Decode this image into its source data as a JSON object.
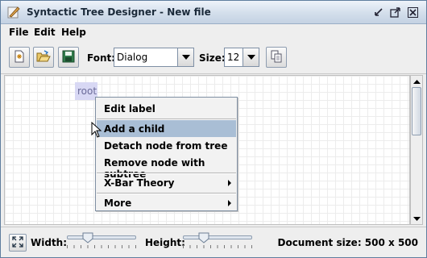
{
  "window": {
    "title": "Syntactic Tree Designer - New file",
    "controls": [
      "minimize-icon",
      "maximize-icon",
      "close-icon"
    ]
  },
  "menubar": {
    "items": [
      "File",
      "Edit",
      "Help"
    ]
  },
  "toolbar": {
    "buttons": [
      "new-file-icon",
      "open-folder-icon",
      "save-disk-icon",
      "copy-icon"
    ],
    "font_label": "Font:",
    "font_value": "Dialog",
    "size_label": "Size:",
    "size_value": "12"
  },
  "canvas": {
    "root_node_label": "root"
  },
  "context_menu": {
    "items": [
      {
        "label": "Edit label",
        "highlighted": false,
        "submenu": false
      },
      {
        "label": "Add a child",
        "highlighted": true,
        "submenu": false
      },
      {
        "label": "Detach node from tree",
        "highlighted": false,
        "submenu": false
      },
      {
        "label": "Remove node with subtree",
        "highlighted": false,
        "submenu": false
      },
      {
        "label": "X-Bar Theory",
        "highlighted": false,
        "submenu": true
      },
      {
        "label": "More",
        "highlighted": false,
        "submenu": true
      }
    ]
  },
  "statusbar": {
    "width_label": "Width:",
    "height_label": "Height:",
    "width_slider_level": 0.3,
    "height_slider_level": 0.3,
    "document_size": "Document size: 500 x 500"
  },
  "colors": {
    "highlight": "#a9bed5",
    "node_bg": "#d8d8f4",
    "node_text": "#6b6b99"
  }
}
